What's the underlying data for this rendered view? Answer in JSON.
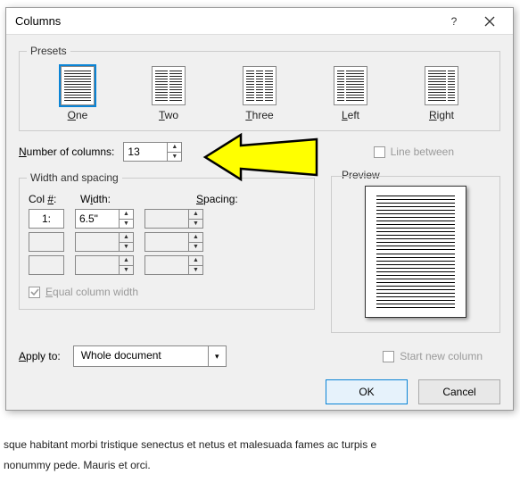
{
  "background": {
    "line_bottom1": "sque habitant morbi tristique senectus et netus et malesuada fames ac turpis e",
    "line_bottom2": "nonummy pede. Mauris et orci."
  },
  "dialog": {
    "title": "Columns",
    "presets_label": "Presets",
    "presets": [
      {
        "key": "one",
        "label_u": "O",
        "label_r": "ne",
        "cols": 1
      },
      {
        "key": "two",
        "label_u": "T",
        "label_r": "wo",
        "cols": 2
      },
      {
        "key": "three",
        "label_u": "T",
        "label_r": "hree",
        "cols": 3
      },
      {
        "key": "left",
        "label_u": "L",
        "label_r": "eft",
        "cols": 2
      },
      {
        "key": "right",
        "label_u": "R",
        "label_r": "ight",
        "cols": 2
      }
    ],
    "num_columns_label_u": "N",
    "num_columns_label_r": "umber of columns:",
    "num_columns_value": "13",
    "line_between_label": "Line between",
    "width_spacing_label": "Width and spacing",
    "col_header_pre": "Col ",
    "col_header_u": "#",
    "col_header_post": ":",
    "width_header_pre": "W",
    "width_header_u": "i",
    "width_header_post": "dth:",
    "spacing_header_u": "S",
    "spacing_header_post": "pacing:",
    "row1_col": "1:",
    "row1_width": "6.5\"",
    "row1_spacing": "",
    "equal_width_label_u": "E",
    "equal_width_label_r": "qual column width",
    "preview_label": "Preview",
    "apply_to_label_u": "A",
    "apply_to_label_r": "pply to:",
    "apply_to_value": "Whole document",
    "start_new_col_label": "Start new column",
    "ok_label": "OK",
    "cancel_label": "Cancel"
  }
}
